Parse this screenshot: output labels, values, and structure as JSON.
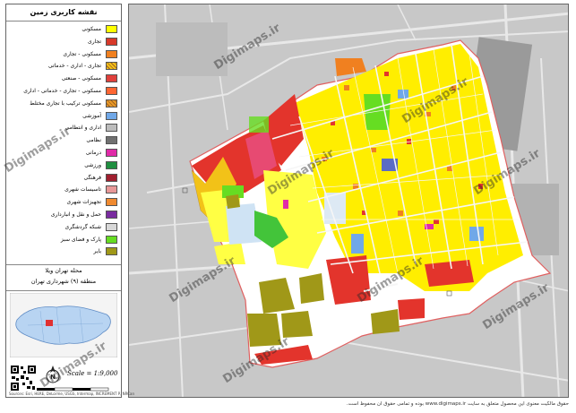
{
  "legend": {
    "title": "نقشه کاربری زمین",
    "items": [
      {
        "label": "مسکونی",
        "color": "#ffff00"
      },
      {
        "label": "تجاری",
        "color": "#d83a2a"
      },
      {
        "label": "مسکونی - تجاری",
        "color": "#f08020"
      },
      {
        "label": "تجاری - اداری - خدماتی",
        "color": "#f2c218",
        "hatch": true
      },
      {
        "label": "مسکونی - صنعتی",
        "color": "#e0403c"
      },
      {
        "label": "مسکونی - تجاری - خدماتی - اداری",
        "color": "#ff6633"
      },
      {
        "label": "مسکونی ترکیب با تجاری مختلط",
        "color": "#e89a28",
        "hatch": true
      },
      {
        "label": "آموزشی",
        "color": "#70a8e8"
      },
      {
        "label": "اداری و انتظامی",
        "color": "#bcbcbc"
      },
      {
        "label": "نظامی",
        "color": "#707070"
      },
      {
        "label": "درمانی",
        "color": "#e02aa8"
      },
      {
        "label": "ورزشی",
        "color": "#1f8f40"
      },
      {
        "label": "فرهنگی",
        "color": "#a01f2f"
      },
      {
        "label": "تاسیسات شهری",
        "color": "#e89898"
      },
      {
        "label": "تجهیزات شهری",
        "color": "#f08a30"
      },
      {
        "label": "حمل و نقل و انبارداری",
        "color": "#7a2ca0"
      },
      {
        "label": "شبکه گردشگری",
        "color": "#d8d8d8"
      },
      {
        "label": "پارک و فضای سبز",
        "color": "#66dd22"
      },
      {
        "label": "بایر",
        "color": "#a09818"
      }
    ]
  },
  "area": {
    "neighborhood": "محله تهران ویلا",
    "district": "منطقه (۹) شهرداری تهران"
  },
  "scale": {
    "text": "Scale = 1:9,000",
    "north_label": "N"
  },
  "watermark": "Digimaps.ir",
  "footer": "حقوق مالکیت معنوی این محصول متعلق به سایت www.digimaps.ir بوده و تمامی حقوق آن محفوظ است.",
  "credit": "Sources: Esri, HERE, DeLorme, USGS, Intermap, INCREMENT P, NRCan",
  "colors": {
    "background": "#c8c8c8",
    "road": "#eeeeee",
    "boundary": "#e05050"
  }
}
